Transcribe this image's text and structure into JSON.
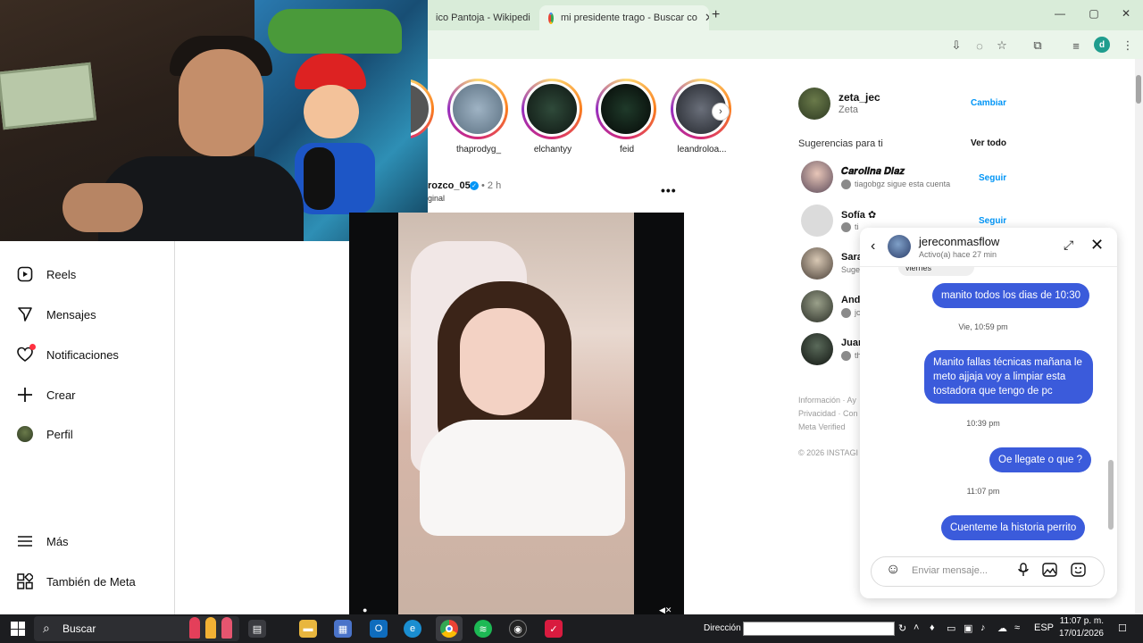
{
  "browser": {
    "tabs": [
      {
        "label": "ico Pantoja - Wikipedi"
      },
      {
        "label": "mi presidente trago - Buscar co"
      }
    ],
    "new_tab": "+",
    "window_controls": {
      "minimize": "—",
      "maximize": "▢",
      "close": "✕"
    },
    "profile_initial": "d"
  },
  "sidebar": {
    "items": [
      {
        "label": "Reels",
        "icon": "reels-icon"
      },
      {
        "label": "Mensajes",
        "icon": "send-icon"
      },
      {
        "label": "Notificaciones",
        "icon": "heart-icon",
        "badge_color": "#ff3040"
      },
      {
        "label": "Crear",
        "icon": "plus-icon"
      },
      {
        "label": "Perfil",
        "icon": "avatar"
      },
      {
        "label": "Más",
        "icon": "menu-icon"
      },
      {
        "label": "También de Meta",
        "icon": "meta-apps-icon"
      }
    ]
  },
  "stories": [
    {
      "name": "thaprodyg_"
    },
    {
      "name": "elchantyy"
    },
    {
      "name": "feid"
    },
    {
      "name": "leandroloa..."
    }
  ],
  "post": {
    "username": "rozco_05",
    "time": "• 2 h",
    "subtitle": "ginal",
    "more": "•••"
  },
  "account": {
    "username": "zeta_jec",
    "name": "Zeta",
    "switch_label": "Cambiar"
  },
  "suggestions": {
    "title": "Sugerencias para ti",
    "see_all": "Ver todo",
    "follow_label": "Seguir",
    "items": [
      {
        "name": "𝑪𝒂𝒓𝒐𝒍𝒊𝒏𝒂 𝑫𝒊𝒂𝒛",
        "sub": "tiagobgz sigue esta cuenta"
      },
      {
        "name": "Sofía ✿",
        "sub": "tiagobgz + 1 más siguen esta"
      },
      {
        "name": "Sara",
        "sub": "Suge"
      },
      {
        "name": "And",
        "sub": "jc"
      },
      {
        "name": "Juan",
        "sub": "th"
      }
    ]
  },
  "footer": {
    "line1": "Información · Ay",
    "line2": "Privacidad · Con",
    "line3": "Meta Verified",
    "copyright": "© 2026 INSTAGI"
  },
  "dm": {
    "name": "jereconmasflow",
    "status": "Activo(a) hace 27 min",
    "previous_fragment": "viernes",
    "messages": [
      {
        "type": "out",
        "text": "manito todos los dias de 10:30"
      },
      {
        "type": "time",
        "text": "Vie, 10:59 pm"
      },
      {
        "type": "out",
        "text": "Manito fallas técnicas mañana le meto ajjaja voy a limpiar esta tostadora que tengo de pc"
      },
      {
        "type": "time",
        "text": "10:39 pm"
      },
      {
        "type": "out",
        "text": "Oe llegate o que ?"
      },
      {
        "type": "time",
        "text": "11:07 pm"
      },
      {
        "type": "out",
        "text": "Cuenteme la historia perrito"
      }
    ],
    "input_placeholder": "Enviar mensaje...",
    "bubble_color": "#3b5bdb"
  },
  "taskbar": {
    "search_label": "Buscar",
    "address_label": "Dirección",
    "language": "ESP",
    "time": "11:07 p. m.",
    "date": "17/01/2026"
  }
}
